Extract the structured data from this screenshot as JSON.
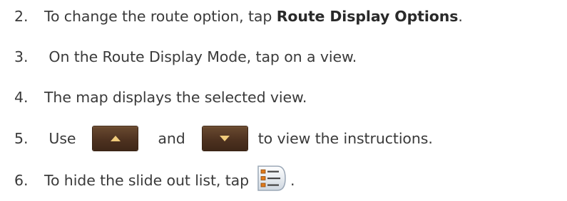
{
  "steps": [
    {
      "number": "2.",
      "text_before": "To change the route option, tap ",
      "bold": "Route Display Options",
      "text_after": "."
    },
    {
      "number": "3.",
      "text": " On the Route Display Mode, tap on a view."
    },
    {
      "number": "4.",
      "text": "The map displays the selected view."
    },
    {
      "number": "5.",
      "text_use": " Use",
      "text_and": "and",
      "text_after": "to view the instructions.",
      "icons": [
        "up-arrow-button-icon",
        "down-arrow-button-icon"
      ]
    },
    {
      "number": "6.",
      "text": "To hide the slide out list, tap",
      "text_after": ".",
      "icon": "list-icon"
    }
  ],
  "colors": {
    "text": "#3a3a3a",
    "button_brown": "#4e3220",
    "arrow_gold": "#f0cb7c",
    "list_orange": "#e07a1a"
  }
}
